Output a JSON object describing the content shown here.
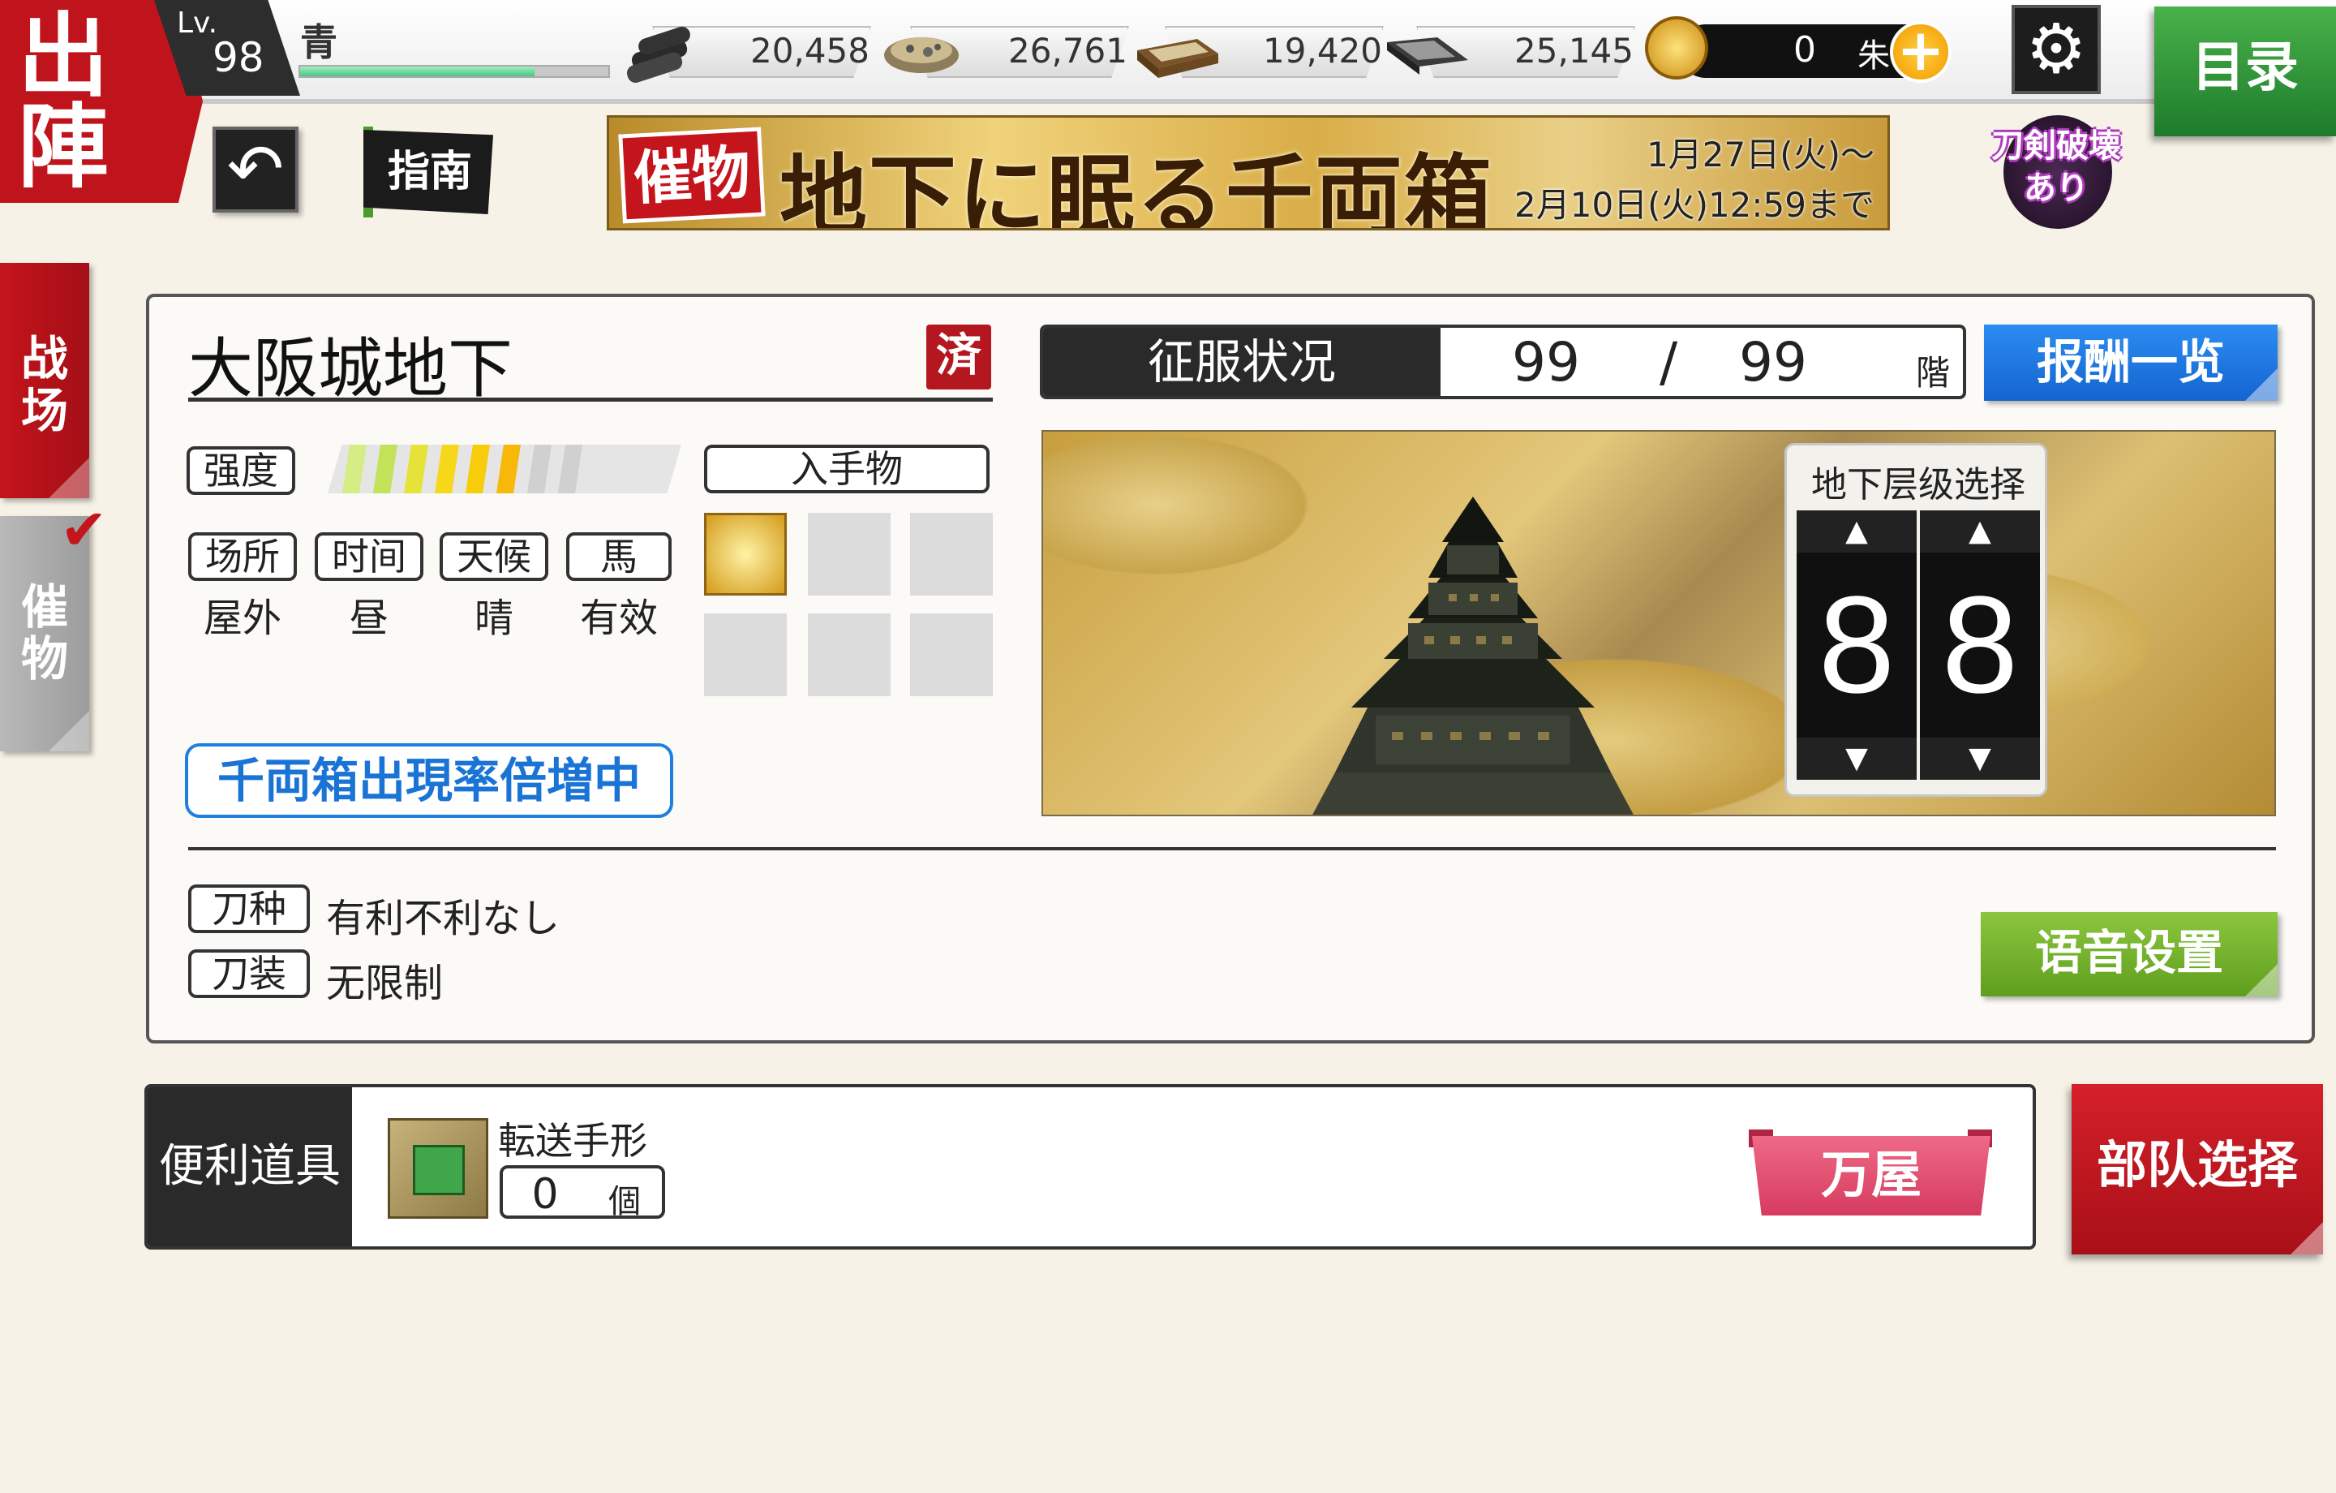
{
  "header": {
    "sortie_label": [
      "出",
      "陣"
    ],
    "level_label": "Lv.",
    "level": "98",
    "player_name": "青",
    "exp_fraction": 0.76,
    "resources": [
      {
        "name": "charcoal",
        "icon": "charcoal-icon",
        "value": "20,458"
      },
      {
        "name": "steel",
        "icon": "steel-ore-icon",
        "value": "26,761"
      },
      {
        "name": "cooling-material",
        "icon": "cooling-box-icon",
        "value": "19,420"
      },
      {
        "name": "whetstone",
        "icon": "whetstone-icon",
        "value": "25,145"
      }
    ],
    "coins": {
      "value": "0",
      "unit": "朱",
      "plus": "+"
    },
    "settings_icon": "gear-icon",
    "menu_label": "目录"
  },
  "nav": {
    "back_icon": "back-arrow-icon",
    "guide_label": "指南"
  },
  "event_banner": {
    "tag": "催物",
    "title": "地下に眠る千両箱",
    "date_start": "1月27日(火)〜",
    "date_end": "2月10日(火)12:59まで"
  },
  "destroy_badge": {
    "line1": "刀剣破壊",
    "line2": "あり"
  },
  "side_tabs": [
    {
      "label": "战\n场",
      "active": true
    },
    {
      "label": "催\n物",
      "active": false,
      "checked": true
    }
  ],
  "stage": {
    "title": "大阪城地下",
    "cleared_mark": "済",
    "strength_label": "强度",
    "strength_level": 6,
    "strength_max": 8,
    "obtain_label": "入手物",
    "conditions": [
      {
        "label": "场所",
        "value": "屋外"
      },
      {
        "label": "时间",
        "value": "昼"
      },
      {
        "label": "天候",
        "value": "晴"
      },
      {
        "label": "馬",
        "value": "有效"
      }
    ],
    "boost_label": "千両箱出現率倍増中",
    "conquest": {
      "label": "征服状况",
      "current": "99",
      "separator": "/",
      "max": "99",
      "unit": "階"
    },
    "rewards_button": "报酬一览",
    "floor_picker": {
      "label": "地下层级选择",
      "digits": [
        "8",
        "8"
      ],
      "up": "▲",
      "down": "▼"
    },
    "rules": [
      {
        "label": "刀种",
        "value": "有利不利なし"
      },
      {
        "label": "刀装",
        "value": "无限制"
      }
    ],
    "voice_button": "语音设置"
  },
  "items": {
    "bar_label": "便利道具",
    "item_name": "転送手形",
    "item_count": "0",
    "item_unit": "個",
    "shop_button": "万屋"
  },
  "squad_button": "部队选择",
  "colors": {
    "red": "#c0141c",
    "blue": "#1f7fe0",
    "green": "#5f9e1d",
    "pink": "#d63b5f"
  }
}
